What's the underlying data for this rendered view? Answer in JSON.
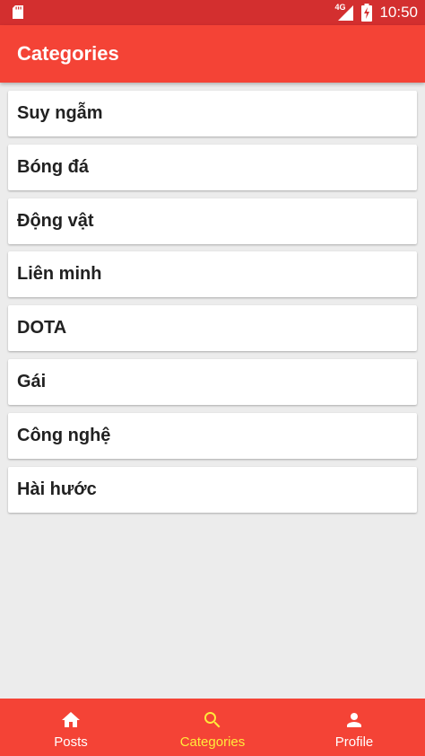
{
  "status_bar": {
    "network": "4G",
    "time": "10:50"
  },
  "app_bar": {
    "title": "Categories"
  },
  "categories": [
    "Suy ngẫm",
    "Bóng đá",
    "Động vật",
    "Liên minh",
    "DOTA",
    "Gái",
    "Công nghệ",
    "Hài hước"
  ],
  "bottom_nav": {
    "items": [
      {
        "label": "Posts",
        "icon": "home-icon"
      },
      {
        "label": "Categories",
        "icon": "search-icon",
        "active": true
      },
      {
        "label": "Profile",
        "icon": "person-icon"
      }
    ]
  },
  "colors": {
    "primary": "#f44336",
    "status_bar": "#d32f2f",
    "active_tab": "#ffeb3b",
    "background": "#ececec"
  }
}
